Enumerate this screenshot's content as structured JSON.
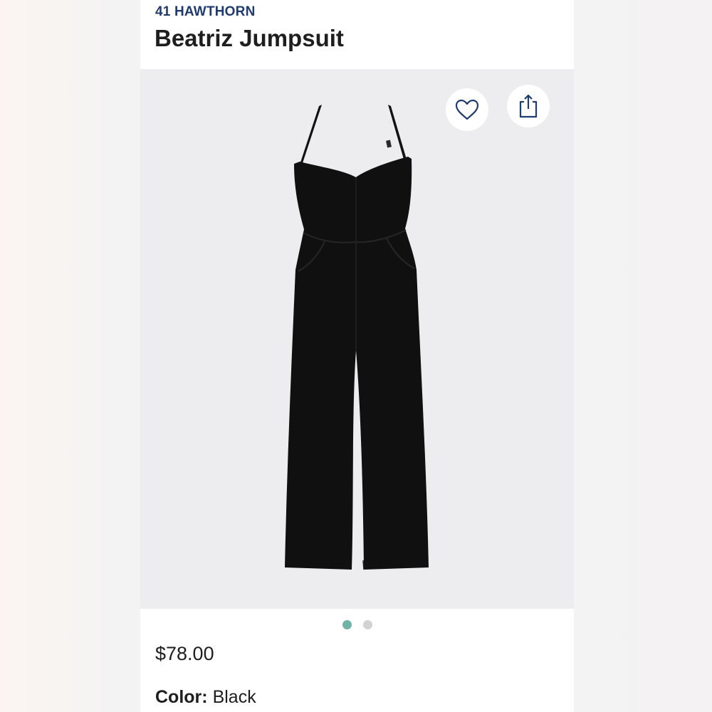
{
  "product": {
    "brand": "41 HAWTHORN",
    "name": "Beatriz Jumpsuit",
    "price": "$78.00",
    "color_label": "Color:",
    "color_value": "Black"
  },
  "image_carousel": {
    "image_count": 2,
    "active_index": 0
  },
  "actions": {
    "favorite_icon": "heart-icon",
    "share_icon": "share-icon"
  },
  "colors": {
    "brand_text": "#1f3b70",
    "active_dot": "#6fb3a6",
    "inactive_dot": "#d2d2d2",
    "image_background": "#ededef"
  }
}
